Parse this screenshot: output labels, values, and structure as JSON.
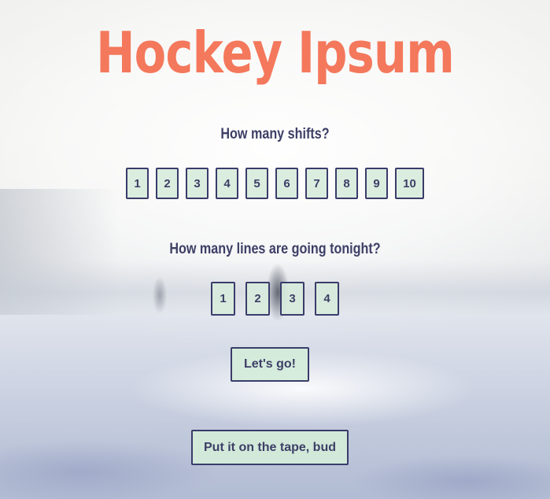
{
  "app": {
    "title": "Hockey Ipsum"
  },
  "shifts": {
    "question": "How many shifts?",
    "options": [
      "1",
      "2",
      "3",
      "4",
      "5",
      "6",
      "7",
      "8",
      "9",
      "10"
    ]
  },
  "lines": {
    "question": "How many lines are going tonight?",
    "options": [
      "1",
      "2",
      "3",
      "4"
    ]
  },
  "actions": {
    "go_label": "Let's go!",
    "tape_label": "Put it on the tape, bud"
  },
  "colors": {
    "title": "#f4785c",
    "text": "#3d3f66",
    "button_bg": "#d7ebdc",
    "button_border": "#3a3c6a"
  }
}
